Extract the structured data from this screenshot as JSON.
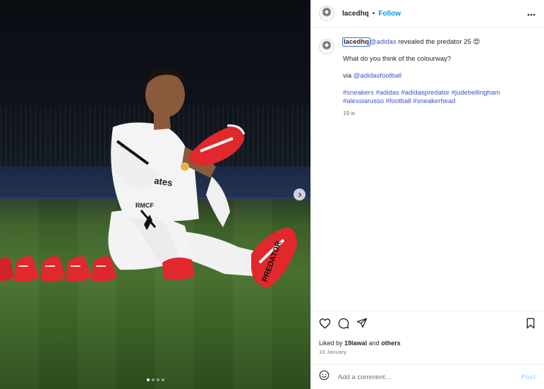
{
  "account": {
    "username": "lacedhq",
    "separator": "•",
    "follow_label": "Follow"
  },
  "icons": {
    "avatar": "sunburst-logo-icon",
    "more": "more-horizontal-icon",
    "carousel_next": "chevron-right-icon",
    "like": "heart-icon",
    "comment": "comment-bubble-icon",
    "share": "paper-plane-icon",
    "save": "bookmark-icon",
    "emoji": "smiley-icon"
  },
  "caption": {
    "author": "lacedhq",
    "mention": "@adidas",
    "text": "revealed the predator 25",
    "emoji": "😍",
    "line2": "What do you think of the colourway?",
    "via_prefix": "via",
    "via_mention": "@adidasfootball",
    "hashtags": [
      "#sneakers",
      "#adidas",
      "#adidaspredator",
      "#judebellingham",
      "#alessiarusso",
      "#football",
      "#sneakerhead"
    ],
    "time": "19 w"
  },
  "stats": {
    "liked_prefix": "Liked by",
    "liked_user": "19lawal",
    "liked_and": "and",
    "liked_others": "others",
    "date": "10 January"
  },
  "comment_box": {
    "placeholder": "Add a comment…",
    "post_label": "Post"
  },
  "carousel": {
    "total": 4,
    "active": 1
  },
  "colors": {
    "accent": "#0095f6",
    "mention": "#3b53d3",
    "boot_red": "#e0282d",
    "kit_white": "#f2f2f2"
  }
}
